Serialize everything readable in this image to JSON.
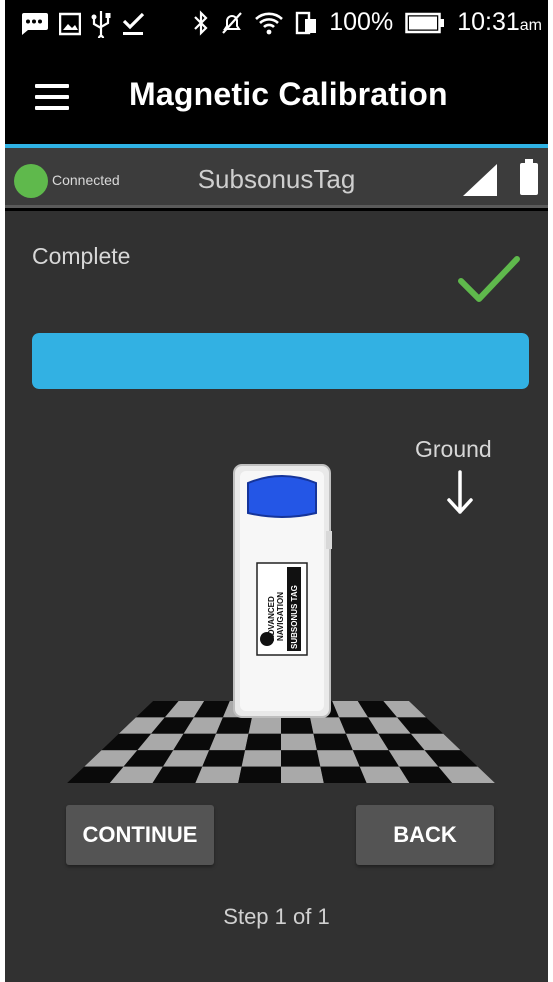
{
  "status_bar": {
    "battery_percent": "100%",
    "time": "10:31",
    "time_suffix": "am",
    "icons": [
      "message-icon",
      "image-icon",
      "usb-icon",
      "download-done-icon",
      "bluetooth-icon",
      "silent-icon",
      "wifi-icon",
      "sim-icon",
      "battery-icon"
    ]
  },
  "app_bar": {
    "title": "Magnetic Calibration",
    "menu_icon": "hamburger-icon"
  },
  "connection": {
    "status_label": "Connected",
    "status_color": "#5fb94c",
    "device_name": "SubsonusTag",
    "signal_icon": "signal-icon",
    "battery_icon": "battery-icon"
  },
  "calibration": {
    "status_text": "Complete",
    "status_icon": "checkmark-icon",
    "check_color": "#5fb94c",
    "progress_percent": 100,
    "progress_color": "#32b1e3",
    "ground_label": "Ground",
    "ground_icon": "arrow-down-icon",
    "device_label_lines": [
      "ADVANCED",
      "NAVIGATION",
      "SUBSONUS TAG"
    ]
  },
  "buttons": {
    "continue_label": "CONTINUE",
    "back_label": "BACK"
  },
  "footer": {
    "step_text": "Step 1 of 1"
  },
  "colors": {
    "accent": "#2fb2e4",
    "background": "#313131",
    "button": "#545454"
  }
}
